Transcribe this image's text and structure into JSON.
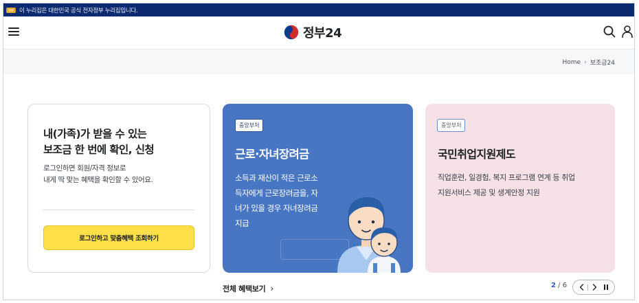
{
  "gov_banner": {
    "text": "이 누리집은 대한민국 공식 전자정부 누리집입니다."
  },
  "header": {
    "logo_text": "정부24"
  },
  "breadcrumb": {
    "home": "Home",
    "current": "보조금24"
  },
  "login_card": {
    "title_line1": "내(가족)가 받을 수 있는",
    "title_line2": "보조금 한 번에 확인, 신청",
    "desc_line1": "로그인하면 회원/자격 정보로",
    "desc_line2": "내게 딱 맞는 혜택을 확인할 수 있어요.",
    "button": "로그인하고 맞춤혜택 조회하기"
  },
  "cards": [
    {
      "badge": "중앙부처",
      "title": "근로·자녀장려금",
      "desc_lines": [
        "소득과 재산이 적은 근로소",
        "득자에게 근로장려금을, 자",
        "녀가 있을 경우 자녀장려금",
        "지급"
      ],
      "bg_color": "#4876c3"
    },
    {
      "badge": "중앙부처",
      "title": "국민취업지원제도",
      "desc_lines": [
        "직업훈련, 일경험, 복지 프로그램 연계 등 취업",
        "지원서비스 제공 및 생계안정 지원"
      ],
      "bg_color": "#f5e1e6"
    }
  ],
  "view_all": {
    "label": "전체 혜택보기"
  },
  "pager": {
    "current": "2",
    "separator": "/",
    "total": "6"
  },
  "icons": [
    "menu-icon",
    "search-icon",
    "user-icon",
    "chevron-right-icon",
    "prev-icon",
    "next-icon",
    "pause-icon"
  ]
}
